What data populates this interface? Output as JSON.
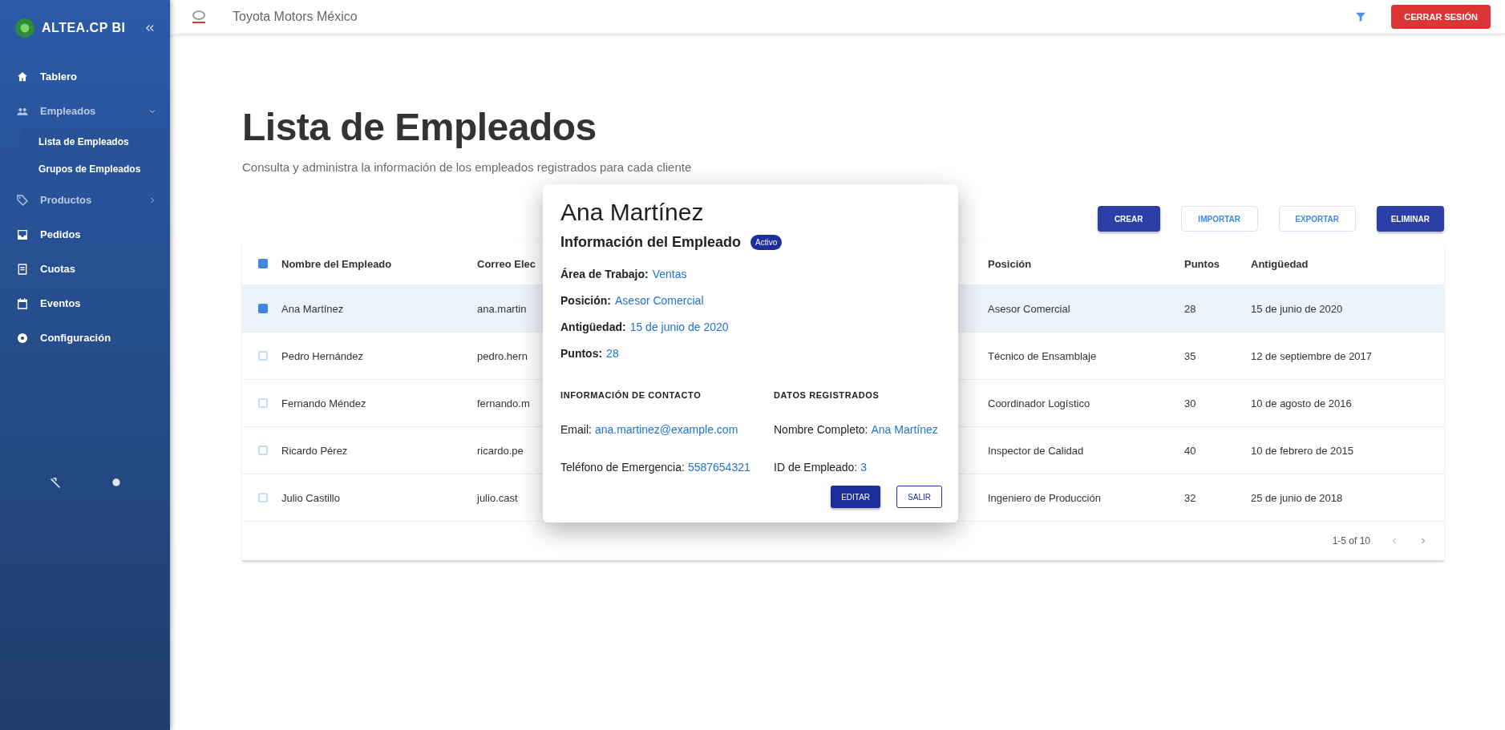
{
  "sidebar": {
    "logo": "ALTEA.CP BI",
    "items": [
      {
        "label": "Tablero",
        "selected": false
      },
      {
        "label": "Empleados",
        "selected": false,
        "expanded": true,
        "children": [
          {
            "label": "Lista de Empleados",
            "selected": true
          },
          {
            "label": "Grupos de Empleados",
            "selected": false
          }
        ]
      },
      {
        "label": "Productos",
        "selected": false,
        "expanded": false
      },
      {
        "label": "Pedidos",
        "selected": false
      },
      {
        "label": "Cuotas",
        "selected": false
      },
      {
        "label": "Eventos",
        "selected": false
      },
      {
        "label": "Configuración",
        "selected": false
      }
    ]
  },
  "header": {
    "client": "Toyota Motors México",
    "logout": "CERRAR SESIÓN"
  },
  "page": {
    "title": "Lista de Empleados",
    "subtitle": "Consulta y administra la información de los empleados registrados para cada cliente"
  },
  "actions": [
    {
      "label": "CREAR",
      "kind": "filled"
    },
    {
      "label": "IMPORTAR",
      "kind": "outlined"
    },
    {
      "label": "EXPORTAR",
      "kind": "outlined"
    },
    {
      "label": "ELIMINAR",
      "kind": "filled"
    }
  ],
  "table": {
    "header_checked": true,
    "columns": [
      "Nombre del Empleado",
      "Correo Elec",
      "Posición",
      "Puntos",
      "Antigüedad"
    ],
    "rows": [
      {
        "selected": true,
        "cells": [
          "Ana Martínez",
          "ana.martin",
          "Asesor Comercial",
          "28",
          "15 de junio de 2020"
        ]
      },
      {
        "selected": false,
        "cells": [
          "Pedro Hernández",
          "pedro.hern",
          "Técnico de Ensamblaje",
          "35",
          "12 de septiembre de 2017"
        ]
      },
      {
        "selected": false,
        "cells": [
          "Fernando Méndez",
          "fernando.m",
          "Coordinador Logístico",
          "30",
          "10 de agosto de 2016"
        ]
      },
      {
        "selected": false,
        "cells": [
          "Ricardo Pérez",
          "ricardo.pe",
          "Inspector de Calidad",
          "40",
          "10 de febrero de 2015"
        ]
      },
      {
        "selected": false,
        "cells": [
          "Julio Castillo",
          "julio.cast",
          "Ingeniero de Producción",
          "32",
          "25 de junio de 2018"
        ]
      }
    ],
    "pagination": "1-5 of 10"
  },
  "dialog": {
    "title": "Ana Martínez",
    "heading": "Información del Empleado",
    "status": "Activo",
    "fields": [
      {
        "label": "Área de Trabajo:",
        "value": "Ventas"
      },
      {
        "label": "Posición:",
        "value": "Asesor Comercial"
      },
      {
        "label": "Antigüedad:",
        "value": "15 de junio de 2020"
      },
      {
        "label": "Puntos:",
        "value": "28"
      }
    ],
    "sections": [
      {
        "title": "INFORMACIÓN DE CONTACTO",
        "items": [
          {
            "label": "Email:",
            "value": "ana.martinez@example.com"
          },
          {
            "label": "Teléfono de Emergencia:",
            "value": "5587654321"
          }
        ]
      },
      {
        "title": "DATOS REGISTRADOS",
        "items": [
          {
            "label": "Nombre Completo:",
            "value": "Ana Martínez"
          },
          {
            "label": "ID de Empleado:",
            "value": "3"
          }
        ]
      }
    ],
    "buttons": [
      {
        "label": "EDITAR",
        "kind": "filled"
      },
      {
        "label": "SALIR",
        "kind": "outlined"
      }
    ]
  }
}
